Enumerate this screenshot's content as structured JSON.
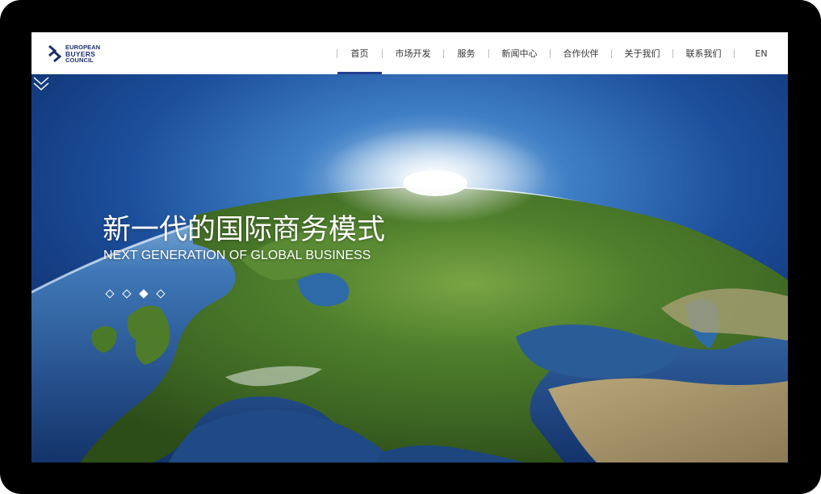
{
  "logo": {
    "line1": "EUROPEAN",
    "line2": "BUYERS",
    "line3": "COUNCIL",
    "icon": "double-chevron-logo-icon",
    "color": "#1d2f6b"
  },
  "nav": {
    "items": [
      {
        "label": "首页",
        "active": true
      },
      {
        "label": "市场开发",
        "active": false
      },
      {
        "label": "服务",
        "active": false
      },
      {
        "label": "新闻中心",
        "active": false
      },
      {
        "label": "合作伙伴",
        "active": false
      },
      {
        "label": "关于我们",
        "active": false
      },
      {
        "label": "联系我们",
        "active": false
      },
      {
        "label": "EN",
        "active": false
      }
    ],
    "active_color": "#243f8f"
  },
  "hero": {
    "title": "新一代的国际商务模式",
    "subtitle": "NEXT GENERATION OF GLOBAL BUSINESS",
    "slides_total": 4,
    "active_slide": 3,
    "scroll_icon": "double-chevron-down-icon"
  }
}
